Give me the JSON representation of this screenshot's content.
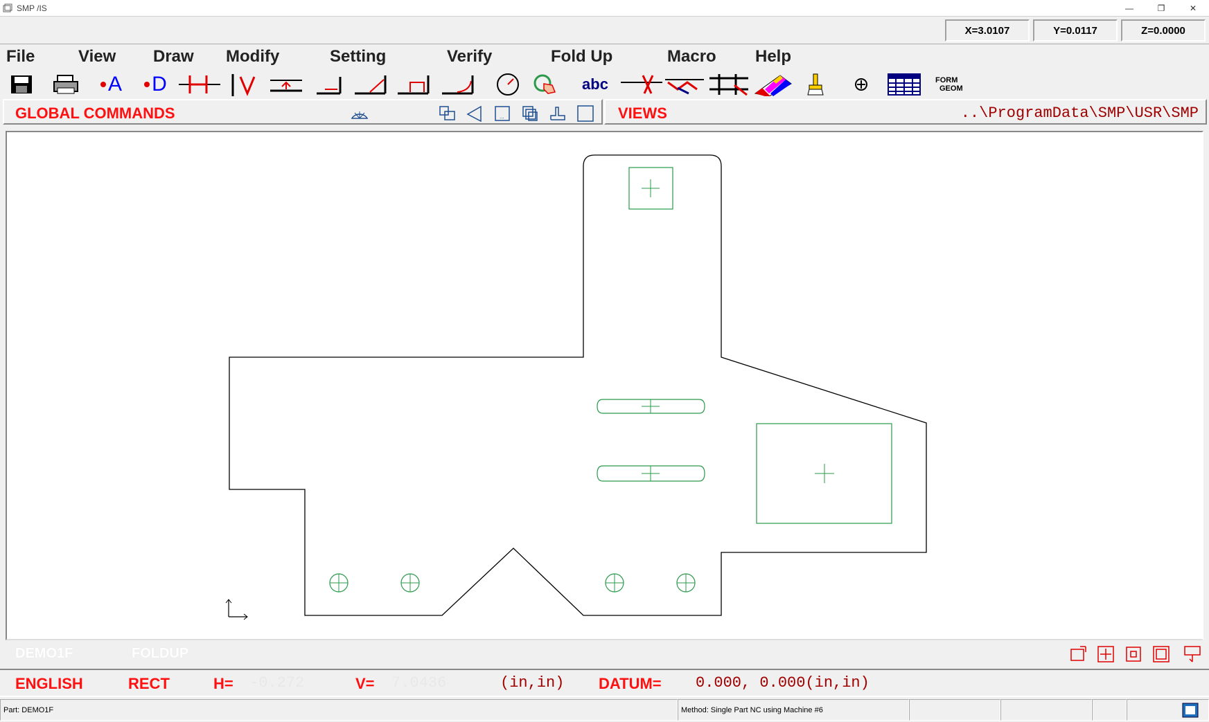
{
  "window": {
    "title": "SMP /IS"
  },
  "coords": {
    "x": "X=3.0107",
    "y": "Y=0.0117",
    "z": "Z=0.0000"
  },
  "menu": [
    {
      "label": "File",
      "name": "menu-file"
    },
    {
      "label": "View",
      "name": "menu-view"
    },
    {
      "label": "Draw",
      "name": "menu-draw"
    },
    {
      "label": "Modify",
      "name": "menu-modify"
    },
    {
      "label": "Setting",
      "name": "menu-setting"
    },
    {
      "label": "Verify",
      "name": "menu-verify"
    },
    {
      "label": "Fold Up",
      "name": "menu-fold-up"
    },
    {
      "label": "Macro",
      "name": "menu-macro"
    },
    {
      "label": "Help",
      "name": "menu-help"
    }
  ],
  "toolbar": {
    "text_a": "A",
    "text_d": "D",
    "text_abc": "abc",
    "form_geom_1": "FORM",
    "form_geom_2": "GEOM"
  },
  "commands": {
    "global_label": "GLOBAL COMMANDS",
    "views_label": "VIEWS",
    "path": "..\\ProgramData\\SMP\\USR\\SMP"
  },
  "part_bar": {
    "part_name": "DEMO1F",
    "mode": "FOLDUP"
  },
  "info_bar": {
    "units": "ENGLISH",
    "mode": "RECT",
    "h_label": "H=",
    "h_value": "-0.272",
    "v_label": "V=",
    "v_value": "7.0436",
    "unit_suffix": "(in,in)",
    "datum_label": "DATUM=",
    "datum_value": "0.000, 0.000(in,in)"
  },
  "status": {
    "part": "Part: DEMO1F",
    "method": "Method: Single Part NC using Machine #6"
  },
  "colors": {
    "accent_red": "#ff1010",
    "path_red": "#a00000",
    "feature_green": "#2a9a4a"
  }
}
